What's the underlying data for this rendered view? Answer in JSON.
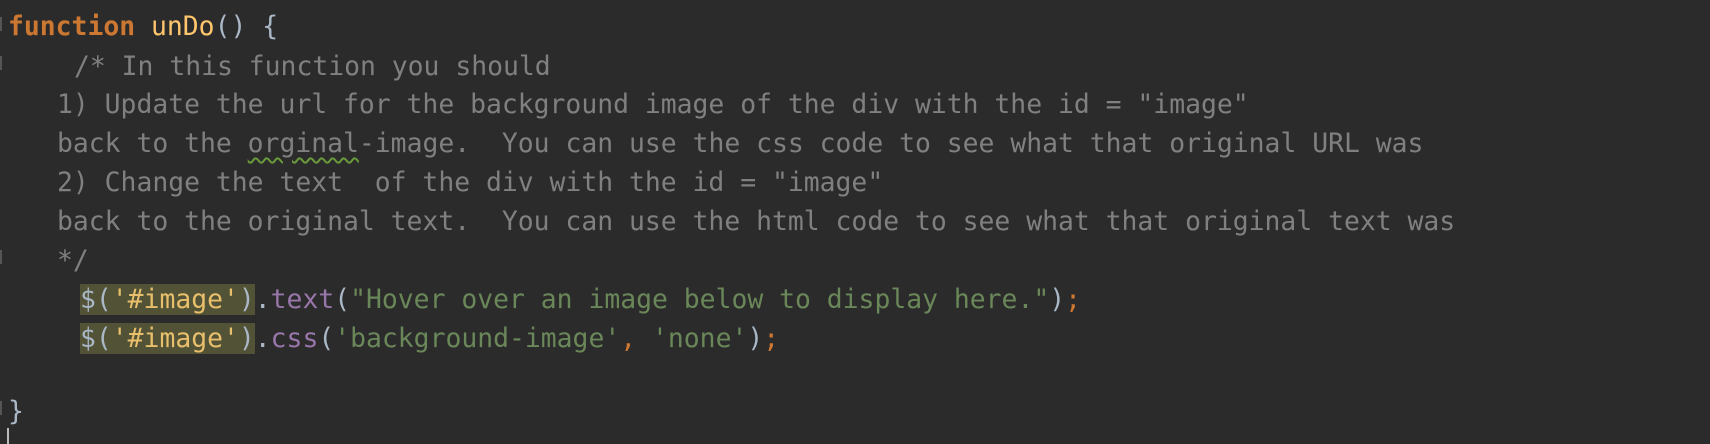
{
  "code": {
    "line1": {
      "keyword": "function",
      "name": "unDo",
      "rest": "() {"
    },
    "line2": {
      "text": "/* In this function you should"
    },
    "line3": {
      "text": "1) Update the url for the background image of the div with the id = \"image\""
    },
    "line4": {
      "before": "back to the ",
      "misspelled": "orginal",
      "after": "-image.  You can use the css code to see what that original URL was"
    },
    "line5": {
      "text": "2) Change the text  of the div with the id = \"image\""
    },
    "line6": {
      "text": "back to the original text.  You can use the html code to see what that original text was"
    },
    "line7": {
      "text": "*/"
    },
    "line8": {
      "dollar": "$",
      "open": "(",
      "selector": "'#image'",
      "close": ")",
      "dot": ".",
      "method": "text",
      "args_open": "(",
      "arg": "\"Hover over an image below to display here.\"",
      "args_close": ")",
      "semicolon": ";"
    },
    "line9": {
      "dollar": "$",
      "open": "(",
      "selector": "'#image'",
      "close": ")",
      "dot": ".",
      "method": "css",
      "args_open": "(",
      "arg1": "'background-image'",
      "comma": ", ",
      "arg2": "'none'",
      "args_close": ")",
      "semicolon": ";"
    },
    "line10": {
      "text": "}"
    }
  },
  "colors": {
    "background": "#2b2b2b",
    "keyword": "#cc7832",
    "function_name": "#ffc66d",
    "comment": "#808080",
    "string": "#6a8759",
    "method": "#9876aa",
    "highlight": "#525236"
  }
}
